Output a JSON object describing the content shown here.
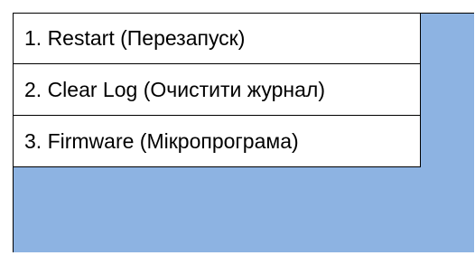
{
  "menu": {
    "items": [
      {
        "label": "1. Restart (Перезапуск)"
      },
      {
        "label": "2. Clear Log (Очистити журнал)"
      },
      {
        "label": "3. Firmware (Мікропрограма)"
      }
    ]
  },
  "colors": {
    "panel_background": "#8db3e2",
    "menu_background": "#ffffff",
    "border": "#000000"
  }
}
